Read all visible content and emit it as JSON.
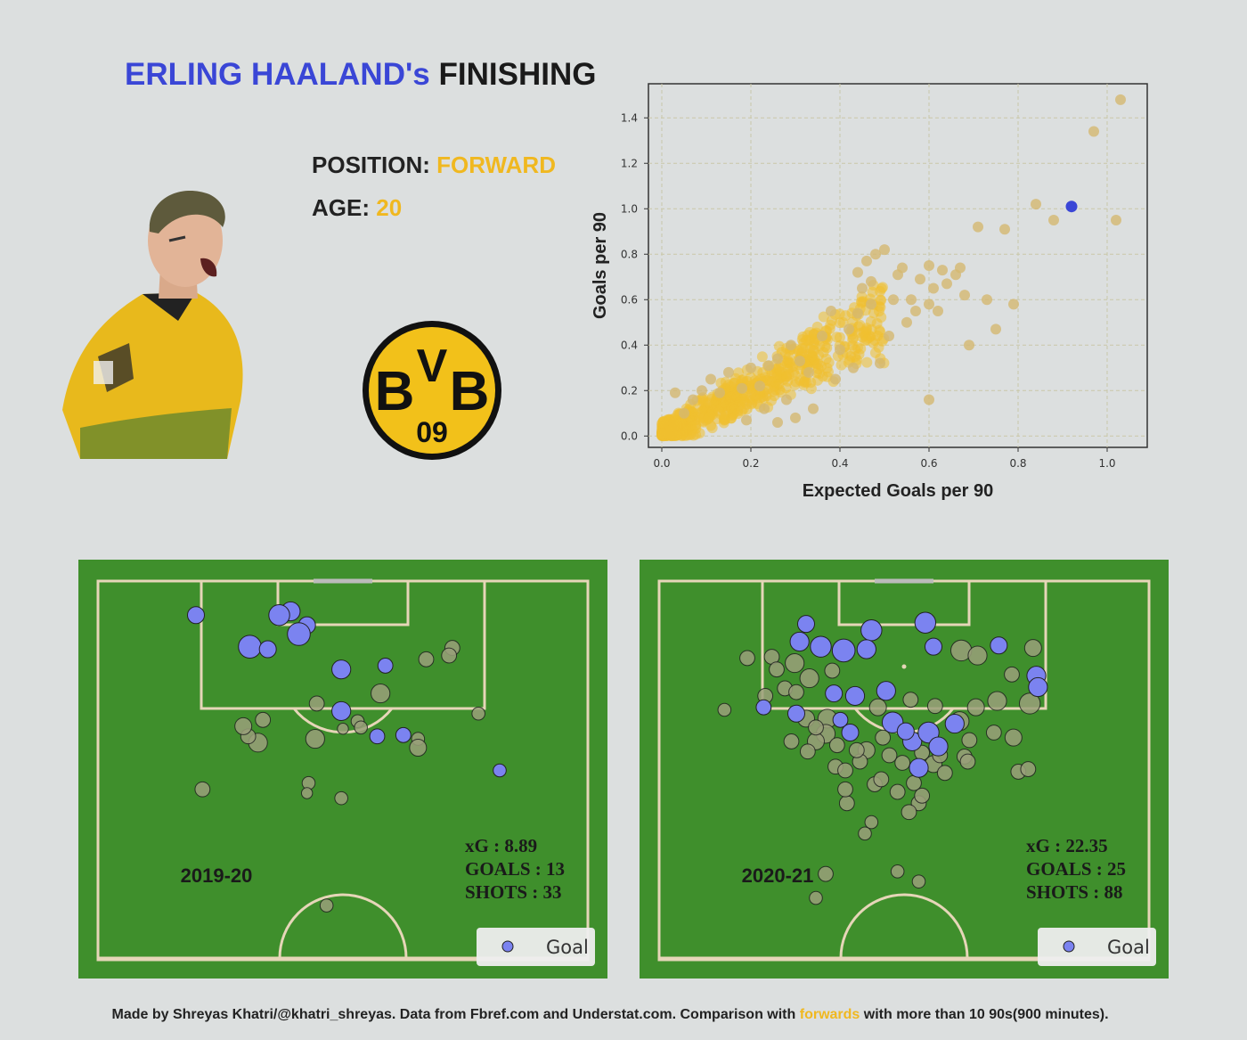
{
  "header": {
    "title_name": "ERLING HAALAND's",
    "title_rest": "FINISHING"
  },
  "player": {
    "position_label": "POSITION:",
    "position_value": "FORWARD",
    "age_label": "AGE:",
    "age_value": "20"
  },
  "crest": {
    "top_letters": "B",
    "middle_letter": "V",
    "right_letter": "B",
    "number": "09",
    "colors": {
      "ring": "#111111",
      "fill": "#f2c11a"
    }
  },
  "colors": {
    "accent_blue": "#3a46d6",
    "accent_yellow": "#f0b820",
    "pitch_green": "#3f8f2c",
    "line_color": "#e6d6b8",
    "goal_fill": "#7b83f0",
    "miss_fill": "#9aa07a"
  },
  "chart_data": [
    {
      "type": "scatter",
      "xlabel": "Expected Goals per 90",
      "ylabel": "Goals per 90",
      "xlim": [
        -0.03,
        1.09
      ],
      "ylim": [
        -0.05,
        1.55
      ],
      "xticks": [
        "0.0",
        "0.2",
        "0.4",
        "0.6",
        "0.8",
        "1.0"
      ],
      "yticks": [
        "0.0",
        "0.2",
        "0.4",
        "0.6",
        "0.8",
        "1.0",
        "1.2",
        "1.4"
      ],
      "grid": true,
      "highlight": {
        "x": 0.92,
        "y": 1.01,
        "color": "#3a46d6"
      },
      "series_color": "#f0c030",
      "outliers": [
        [
          1.03,
          1.48
        ],
        [
          0.97,
          1.34
        ],
        [
          0.88,
          0.95
        ],
        [
          0.84,
          1.02
        ],
        [
          1.02,
          0.95
        ],
        [
          0.71,
          0.92
        ],
        [
          0.77,
          0.91
        ],
        [
          0.79,
          0.58
        ],
        [
          0.73,
          0.6
        ],
        [
          0.75,
          0.47
        ],
        [
          0.69,
          0.4
        ],
        [
          0.66,
          0.71
        ],
        [
          0.68,
          0.62
        ],
        [
          0.67,
          0.74
        ],
        [
          0.58,
          0.69
        ],
        [
          0.6,
          0.75
        ],
        [
          0.61,
          0.65
        ],
        [
          0.57,
          0.55
        ],
        [
          0.6,
          0.58
        ],
        [
          0.54,
          0.74
        ],
        [
          0.53,
          0.71
        ],
        [
          0.48,
          0.8
        ],
        [
          0.5,
          0.82
        ],
        [
          0.56,
          0.6
        ],
        [
          0.55,
          0.5
        ],
        [
          0.47,
          0.68
        ],
        [
          0.45,
          0.65
        ],
        [
          0.6,
          0.16
        ],
        [
          0.51,
          0.44
        ],
        [
          0.44,
          0.54
        ],
        [
          0.42,
          0.47
        ],
        [
          0.4,
          0.38
        ],
        [
          0.38,
          0.55
        ],
        [
          0.36,
          0.44
        ],
        [
          0.47,
          0.58
        ],
        [
          0.52,
          0.6
        ],
        [
          0.49,
          0.32
        ],
        [
          0.43,
          0.3
        ],
        [
          0.39,
          0.25
        ],
        [
          0.33,
          0.28
        ],
        [
          0.29,
          0.4
        ],
        [
          0.31,
          0.33
        ],
        [
          0.26,
          0.34
        ],
        [
          0.24,
          0.31
        ],
        [
          0.22,
          0.22
        ],
        [
          0.2,
          0.3
        ],
        [
          0.18,
          0.21
        ],
        [
          0.15,
          0.28
        ],
        [
          0.13,
          0.19
        ],
        [
          0.11,
          0.25
        ],
        [
          0.09,
          0.2
        ],
        [
          0.07,
          0.16
        ],
        [
          0.03,
          0.19
        ],
        [
          0.05,
          0.1
        ],
        [
          0.28,
          0.16
        ],
        [
          0.34,
          0.12
        ],
        [
          0.3,
          0.08
        ],
        [
          0.26,
          0.06
        ],
        [
          0.23,
          0.12
        ],
        [
          0.19,
          0.07
        ],
        [
          0.63,
          0.73
        ],
        [
          0.62,
          0.55
        ],
        [
          0.64,
          0.67
        ],
        [
          0.46,
          0.77
        ],
        [
          0.44,
          0.72
        ]
      ]
    },
    {
      "type": "scatter",
      "season": "2019-20",
      "xg_text": "xG : 8.89",
      "goals_text": "GOALS : 13",
      "shots_text": "SHOTS : 33",
      "legend": "Goal",
      "goals": [
        [
          12.8,
          3.5,
          0.25
        ],
        [
          12.3,
          4.2,
          0.4
        ],
        [
          11.8,
          2.4,
          0.3
        ],
        [
          11.1,
          2.7,
          0.35
        ],
        [
          6.0,
          2.7,
          0.25
        ],
        [
          9.3,
          5.2,
          0.4
        ],
        [
          10.4,
          5.4,
          0.25
        ],
        [
          14.9,
          7.0,
          0.3
        ],
        [
          17.6,
          6.7,
          0.2
        ],
        [
          14.9,
          10.3,
          0.3
        ],
        [
          18.7,
          12.2,
          0.2
        ],
        [
          17.1,
          12.3,
          0.2
        ],
        [
          24.6,
          15.0,
          0.15
        ]
      ],
      "misses": [
        [
          21.7,
          5.3,
          0.2
        ],
        [
          21.5,
          5.9,
          0.2
        ],
        [
          20.1,
          6.2,
          0.2
        ],
        [
          17.3,
          8.9,
          0.3
        ],
        [
          23.3,
          10.5,
          0.15
        ],
        [
          19.6,
          12.5,
          0.15
        ],
        [
          19.6,
          13.2,
          0.25
        ],
        [
          10.1,
          11.0,
          0.2
        ],
        [
          13.4,
          9.7,
          0.2
        ],
        [
          13.3,
          12.5,
          0.3
        ],
        [
          9.8,
          12.8,
          0.3
        ],
        [
          15.9,
          11.1,
          0.15
        ],
        [
          16.1,
          11.6,
          0.15
        ],
        [
          9.2,
          12.3,
          0.2
        ],
        [
          8.9,
          11.5,
          0.25
        ],
        [
          12.9,
          16.0,
          0.15
        ],
        [
          14.9,
          17.2,
          0.15
        ],
        [
          12.8,
          16.8,
          0.1
        ],
        [
          6.4,
          16.5,
          0.2
        ],
        [
          14.0,
          25.7,
          0.15
        ],
        [
          15.0,
          11.7,
          0.1
        ]
      ]
    },
    {
      "type": "scatter",
      "season": "2020-21",
      "xg_text": "xG : 22.35",
      "goals_text": "GOALS : 25",
      "shots_text": "SHOTS : 88",
      "legend": "Goal",
      "goals": [
        [
          16.3,
          3.3,
          0.35
        ],
        [
          13.0,
          3.9,
          0.35
        ],
        [
          11.3,
          5.5,
          0.4
        ],
        [
          9.0,
          3.4,
          0.25
        ],
        [
          8.6,
          4.8,
          0.3
        ],
        [
          9.9,
          5.2,
          0.35
        ],
        [
          12.7,
          5.4,
          0.3
        ],
        [
          16.8,
          5.2,
          0.25
        ],
        [
          20.8,
          5.1,
          0.25
        ],
        [
          23.1,
          7.5,
          0.3
        ],
        [
          23.2,
          8.4,
          0.3
        ],
        [
          10.7,
          8.9,
          0.25
        ],
        [
          12.0,
          9.1,
          0.3
        ],
        [
          13.9,
          8.7,
          0.3
        ],
        [
          8.4,
          10.5,
          0.25
        ],
        [
          11.1,
          11.0,
          0.2
        ],
        [
          14.3,
          11.2,
          0.35
        ],
        [
          15.5,
          12.7,
          0.3
        ],
        [
          16.5,
          12.0,
          0.35
        ],
        [
          15.1,
          11.9,
          0.25
        ],
        [
          18.1,
          11.3,
          0.3
        ],
        [
          17.1,
          13.1,
          0.3
        ],
        [
          15.9,
          14.8,
          0.3
        ],
        [
          11.7,
          12.0,
          0.25
        ],
        [
          6.4,
          10.0,
          0.2
        ]
      ],
      "misses": [
        [
          8.3,
          6.5,
          0.3
        ],
        [
          6.9,
          6.0,
          0.2
        ],
        [
          5.4,
          6.1,
          0.2
        ],
        [
          18.5,
          5.5,
          0.35
        ],
        [
          19.5,
          5.9,
          0.3
        ],
        [
          22.9,
          5.3,
          0.25
        ],
        [
          21.6,
          7.4,
          0.2
        ],
        [
          22.7,
          9.7,
          0.35
        ],
        [
          20.7,
          9.5,
          0.3
        ],
        [
          19.4,
          10.0,
          0.25
        ],
        [
          18.4,
          11.1,
          0.3
        ],
        [
          13.4,
          10.0,
          0.25
        ],
        [
          9.2,
          7.7,
          0.3
        ],
        [
          7.7,
          8.5,
          0.2
        ],
        [
          6.5,
          9.1,
          0.2
        ],
        [
          4.0,
          10.2,
          0.15
        ],
        [
          9.0,
          10.9,
          0.25
        ],
        [
          10.3,
          10.9,
          0.3
        ],
        [
          10.2,
          12.1,
          0.3
        ],
        [
          9.6,
          12.7,
          0.25
        ],
        [
          8.1,
          12.7,
          0.2
        ],
        [
          9.1,
          13.5,
          0.2
        ],
        [
          10.9,
          13.0,
          0.2
        ],
        [
          12.7,
          13.4,
          0.25
        ],
        [
          14.1,
          13.8,
          0.2
        ],
        [
          10.8,
          14.7,
          0.2
        ],
        [
          11.4,
          15.0,
          0.2
        ],
        [
          16.1,
          13.6,
          0.2
        ],
        [
          16.8,
          14.5,
          0.25
        ],
        [
          17.2,
          13.8,
          0.2
        ],
        [
          15.6,
          16.0,
          0.2
        ],
        [
          14.6,
          16.7,
          0.2
        ],
        [
          13.2,
          16.1,
          0.2
        ],
        [
          15.9,
          17.6,
          0.2
        ],
        [
          15.3,
          18.3,
          0.2
        ],
        [
          11.5,
          17.6,
          0.2
        ],
        [
          22.0,
          15.1,
          0.2
        ],
        [
          22.6,
          14.9,
          0.2
        ],
        [
          21.7,
          12.4,
          0.25
        ],
        [
          18.7,
          13.9,
          0.2
        ],
        [
          13.0,
          19.1,
          0.15
        ],
        [
          12.6,
          20.0,
          0.15
        ],
        [
          10.2,
          23.2,
          0.2
        ],
        [
          14.6,
          23.0,
          0.15
        ],
        [
          15.9,
          23.8,
          0.15
        ],
        [
          9.6,
          25.1,
          0.15
        ],
        [
          13.7,
          12.4,
          0.2
        ],
        [
          16.1,
          17.0,
          0.2
        ],
        [
          8.4,
          8.8,
          0.2
        ],
        [
          9.6,
          11.6,
          0.2
        ],
        [
          12.3,
          14.3,
          0.2
        ],
        [
          17.5,
          15.2,
          0.2
        ],
        [
          19.0,
          12.6,
          0.2
        ],
        [
          20.5,
          12.0,
          0.2
        ],
        [
          11.4,
          16.5,
          0.2
        ],
        [
          16.9,
          9.9,
          0.2
        ],
        [
          15.4,
          9.4,
          0.2
        ],
        [
          10.6,
          7.1,
          0.2
        ],
        [
          7.2,
          7.0,
          0.2
        ],
        [
          13.6,
          15.7,
          0.2
        ],
        [
          12.1,
          13.4,
          0.2
        ],
        [
          18.9,
          14.3,
          0.2
        ],
        [
          14.9,
          14.4,
          0.2
        ]
      ]
    }
  ],
  "footer": {
    "text_before": "Made by Shreyas Khatri/@khatri_shreyas. Data from Fbref.com and Understat.com. Comparison with ",
    "highlight": "forwards",
    "text_after": " with more than 10 90s(900 minutes)."
  }
}
